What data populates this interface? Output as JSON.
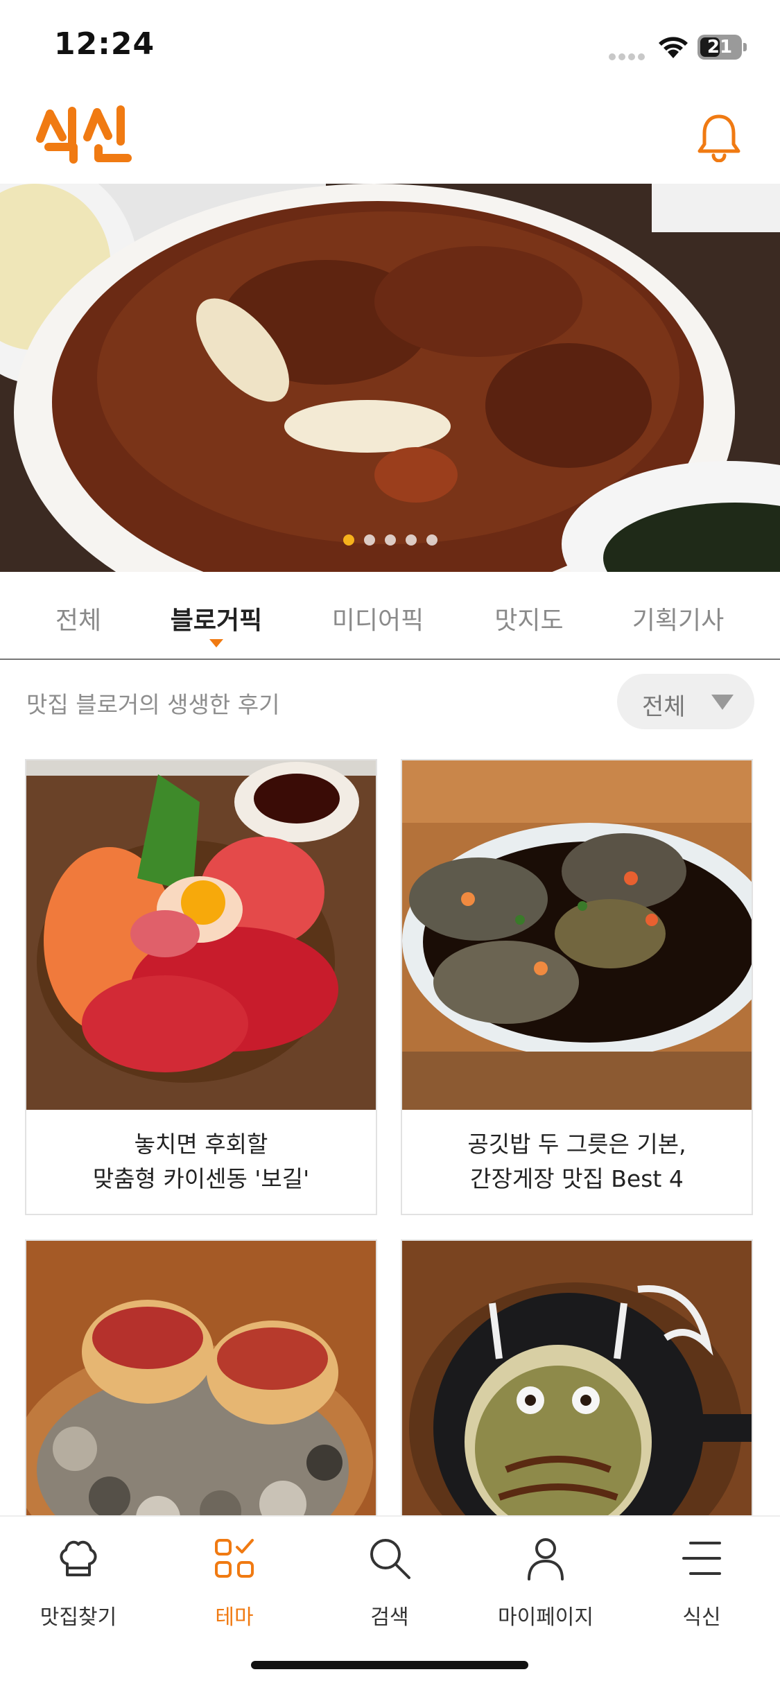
{
  "status_bar": {
    "time": "12:24",
    "battery": "21"
  },
  "header": {
    "logo_text": "식신",
    "accent_color": "#f07a12"
  },
  "hero": {
    "slide_count": 5,
    "active_slide": 1
  },
  "tabs": [
    {
      "label": "전체",
      "active": false
    },
    {
      "label": "블로거픽",
      "active": true
    },
    {
      "label": "미디어픽",
      "active": false
    },
    {
      "label": "맛지도",
      "active": false
    },
    {
      "label": "기획기사",
      "active": false
    }
  ],
  "section": {
    "subtitle": "맛집 블로거의 생생한 후기",
    "filter_label": "전체"
  },
  "cards": [
    {
      "title_line1": "놓치면 후회할",
      "title_line2": "맞춤형 카이센동 '보길'",
      "image": "sashimi-bowl"
    },
    {
      "title_line1": "공깃밥 두 그릇은 기본,",
      "title_line2": "간장게장 맛집 Best 4",
      "image": "soy-crab"
    },
    {
      "title_line1": "",
      "title_line2": "",
      "image": "tartare-cups"
    },
    {
      "title_line1": "",
      "title_line2": "",
      "image": "totoro-okonomiyaki"
    }
  ],
  "bottom_nav": [
    {
      "label": "맛집찾기",
      "icon": "chef-hat-icon",
      "active": false
    },
    {
      "label": "테마",
      "icon": "theme-grid-icon",
      "active": true
    },
    {
      "label": "검색",
      "icon": "search-icon",
      "active": false
    },
    {
      "label": "마이페이지",
      "icon": "person-icon",
      "active": false
    },
    {
      "label": "식신",
      "icon": "menu-icon",
      "active": false
    }
  ]
}
